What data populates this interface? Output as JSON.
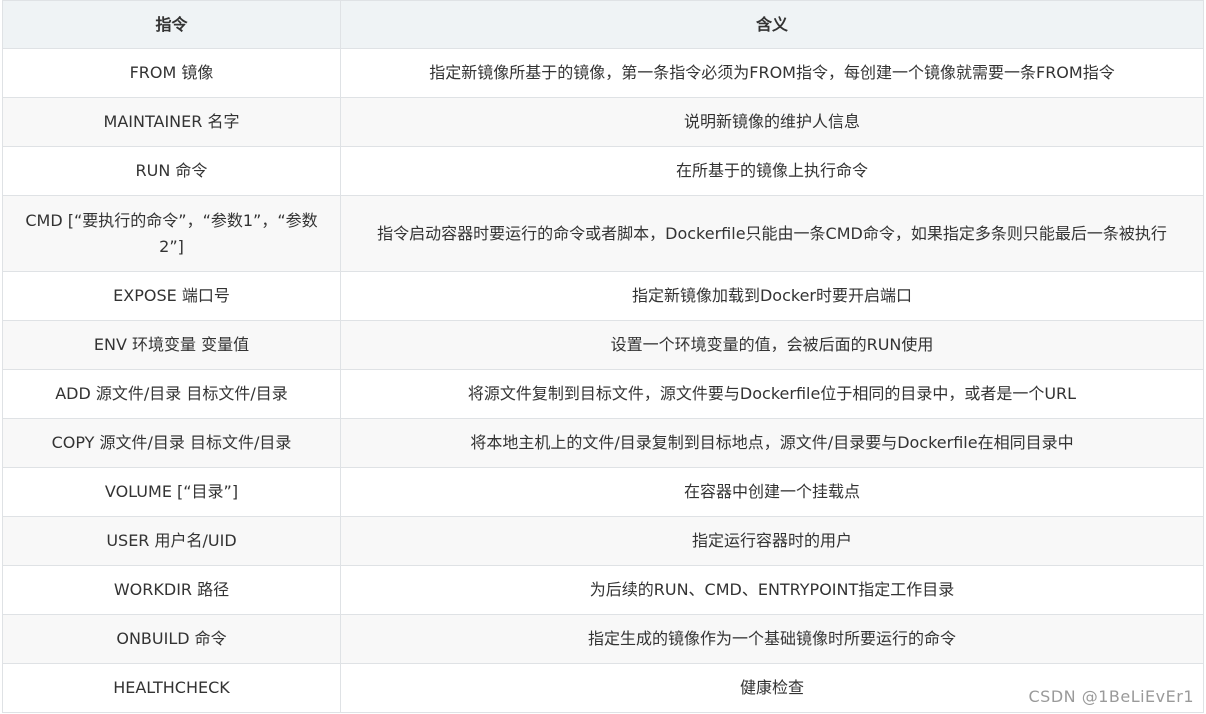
{
  "table": {
    "headers": {
      "command": "指令",
      "meaning": "含义"
    },
    "rows": [
      {
        "command": "FROM 镜像",
        "meaning": "指定新镜像所基于的镜像，第一条指令必须为FROM指令，每创建一个镜像就需要一条FROM指令"
      },
      {
        "command": "MAINTAINER 名字",
        "meaning": "说明新镜像的维护人信息"
      },
      {
        "command": "RUN 命令",
        "meaning": "在所基于的镜像上执行命令"
      },
      {
        "command": "CMD [“要执行的命令”，“参数1”，“参数2”]",
        "meaning": "指令启动容器时要运行的命令或者脚本，Dockerfile只能由一条CMD命令，如果指定多条则只能最后一条被执行"
      },
      {
        "command": "EXPOSE 端口号",
        "meaning": "指定新镜像加载到Docker时要开启端口"
      },
      {
        "command": "ENV 环境变量 变量值",
        "meaning": "设置一个环境变量的值，会被后面的RUN使用"
      },
      {
        "command": "ADD 源文件/目录 目标文件/目录",
        "meaning": "将源文件复制到目标文件，源文件要与Dockerfile位于相同的目录中，或者是一个URL"
      },
      {
        "command": "COPY 源文件/目录 目标文件/目录",
        "meaning": "将本地主机上的文件/目录复制到目标地点，源文件/目录要与Dockerfile在相同目录中"
      },
      {
        "command": "VOLUME [“目录”]",
        "meaning": "在容器中创建一个挂载点"
      },
      {
        "command": "USER 用户名/UID",
        "meaning": "指定运行容器时的用户"
      },
      {
        "command": "WORKDIR 路径",
        "meaning": "为后续的RUN、CMD、ENTRYPOINT指定工作目录"
      },
      {
        "command": "ONBUILD 命令",
        "meaning": "指定生成的镜像作为一个基础镜像时所要运行的命令"
      },
      {
        "command": "HEALTHCHECK",
        "meaning": "健康检查"
      }
    ]
  },
  "watermark": "CSDN @1BeLiEvEr1",
  "colors": {
    "header_bg": "#eff3f5",
    "border": "#dfe2e5",
    "stripe": "#f8f8f8",
    "text": "#333333"
  }
}
